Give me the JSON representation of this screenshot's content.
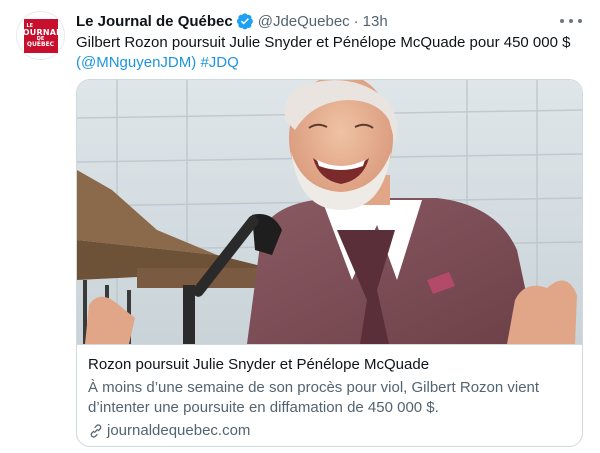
{
  "account": {
    "name": "Le Journal de Québec",
    "handle": "@JdeQuebec",
    "separator": "·",
    "time": "13h",
    "logo_text": [
      "LE",
      "JOURNAL",
      "DE",
      "QUÉBEC"
    ]
  },
  "tweet": {
    "text": "Gilbert Rozon poursuit Julie Snyder et Pénélope McQuade pour 450 000 $",
    "mention_open": "(",
    "mention": "@MNguyenJDM",
    "mention_close": ")",
    "hashtag": "#JDQ"
  },
  "card": {
    "title": "Rozon poursuit Julie Snyder et Pénélope McQuade",
    "description": "À moins d’une semaine de son procès pour viol, Gilbert Rozon vient d’intenter une poursuite en diffamation de 450 000 $.",
    "domain": "journaldequebec.com"
  },
  "icons": {
    "verified": "verified-badge-icon",
    "more": "more-options-icon",
    "link": "link-icon"
  },
  "colors": {
    "link_blue": "#1b95e0",
    "verified_blue": "#1da1f2",
    "brand_red": "#c8102e",
    "secondary_text": "#536471"
  }
}
